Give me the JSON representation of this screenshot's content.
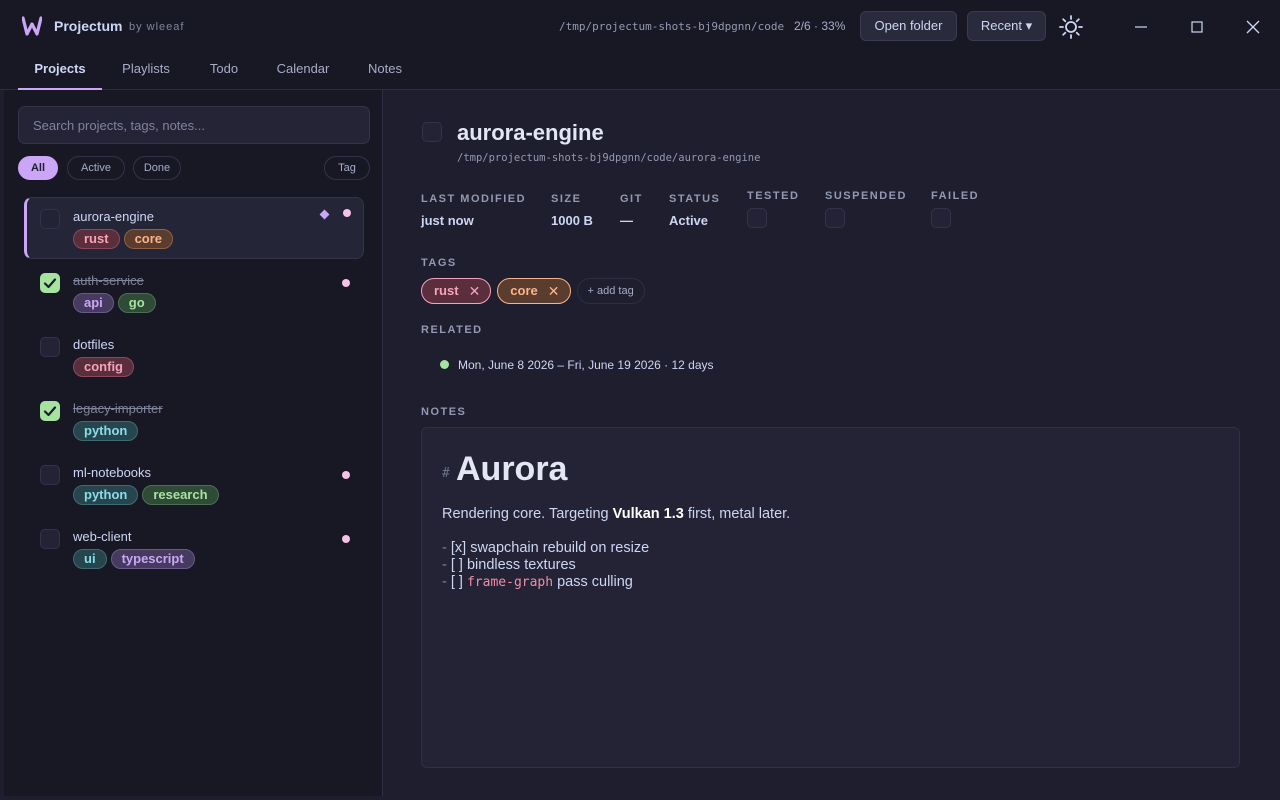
{
  "app": {
    "title": "Projectum",
    "by": "by wleeaf",
    "path": "/tmp/projectum-shots-bj9dpgnn/code",
    "progress": "2/6 · 33%",
    "open_folder": "Open folder",
    "recent": "Recent ▾"
  },
  "tabs": [
    "Projects",
    "Playlists",
    "Todo",
    "Calendar",
    "Notes"
  ],
  "sidebar": {
    "search_placeholder": "Search projects, tags, notes...",
    "filters": [
      "All",
      "Active",
      "Done",
      "Tag"
    ],
    "projects": [
      {
        "name": "aurora-engine",
        "done": false,
        "tags": [
          "rust",
          "core"
        ]
      },
      {
        "name": "auth-service",
        "done": true,
        "tags": [
          "api",
          "go"
        ]
      },
      {
        "name": "dotfiles",
        "done": false,
        "tags": [
          "config"
        ]
      },
      {
        "name": "legacy-importer",
        "done": true,
        "tags": [
          "python"
        ]
      },
      {
        "name": "ml-notebooks",
        "done": false,
        "tags": [
          "python",
          "research"
        ]
      },
      {
        "name": "web-client",
        "done": false,
        "tags": [
          "ui",
          "typescript"
        ]
      }
    ]
  },
  "detail": {
    "title": "aurora-engine",
    "path": "/tmp/projectum-shots-bj9dpgnn/code/aurora-engine",
    "meta": {
      "last_modified_label": "LAST MODIFIED",
      "last_modified": "just now",
      "size_label": "SIZE",
      "size": "1000 B",
      "git_label": "GIT",
      "git": "—",
      "status_label": "STATUS",
      "status": "Active",
      "tested_label": "TESTED",
      "suspended_label": "SUSPENDED",
      "failed_label": "FAILED"
    },
    "tags_label": "TAGS",
    "tags": [
      "rust",
      "core"
    ],
    "add_tag": "+ add tag",
    "related_label": "RELATED",
    "related": "Mon, June 8 2026 – Fri, June 19 2026 · 12 days",
    "notes_label": "NOTES",
    "notes": {
      "hash": "#",
      "heading": "Aurora",
      "para_before": "Rendering core. Targeting ",
      "para_bold": "Vulkan 1.3",
      "para_after": " first, metal later.",
      "lines": [
        {
          "dash": "- ",
          "check": "[x]",
          "text": " swapchain rebuild on resize"
        },
        {
          "dash": "- ",
          "check": "[ ]",
          "text": " bindless textures"
        },
        {
          "dash": "- ",
          "check": "[ ]",
          "code": "frame-graph",
          "text": " pass culling"
        }
      ]
    }
  },
  "colors": {
    "accent": "#cba6f7",
    "background": "#1e1e2e",
    "panel": "#181825",
    "done_green": "#a6e3a1",
    "dot_pink": "#f5c2e7"
  }
}
